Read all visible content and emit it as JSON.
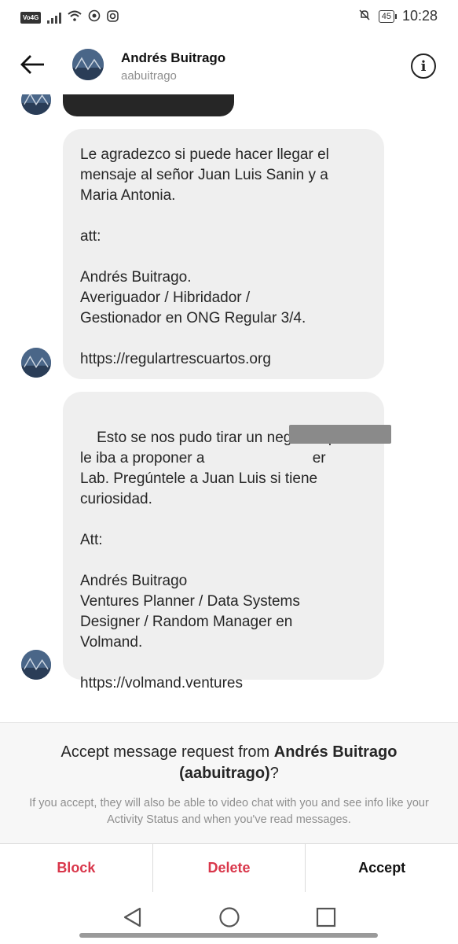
{
  "status_bar": {
    "volte": "VoLTE 4G",
    "battery": "45",
    "time": "10:28"
  },
  "header": {
    "name": "Andrés Buitrago",
    "username": "aabuitrago",
    "info_icon": "info-icon",
    "back_icon": "back-arrow-icon"
  },
  "messages": [
    {
      "text": "Le agradezco si puede hacer llegar el\nmensaje al señor Juan Luis Sanin y a\nMaria Antonia.\n\natt:\n\nAndrés Buitrago.\nAveriguador / Hibridador /\nGestionador en ONG Regular 3/4.\n\nhttps://regulartrescuartos.org"
    },
    {
      "text": "Esto se nos pudo tirar un negocio que\nle iba a proponer a                          er\nLab. Pregúntele a Juan Luis si tiene\ncuriosidad.\n\nAtt:\n\nAndrés Buitrago\nVentures Planner / Data Systems\nDesigner / Random Manager en\nVolmand.\n\nhttps://volmand.ventures"
    }
  ],
  "request": {
    "prefix": "Accept message request from ",
    "name": "Andrés Buitrago",
    "username_paren": "(aabuitrago)",
    "suffix": "?",
    "subtitle": "If you accept, they will also be able to video chat with you and see info like your Activity Status and when you've read messages."
  },
  "actions": {
    "block": "Block",
    "delete": "Delete",
    "accept": "Accept"
  },
  "colors": {
    "danger": "#d9374b",
    "bubble": "#efefef",
    "muted": "#8e8e8e"
  }
}
